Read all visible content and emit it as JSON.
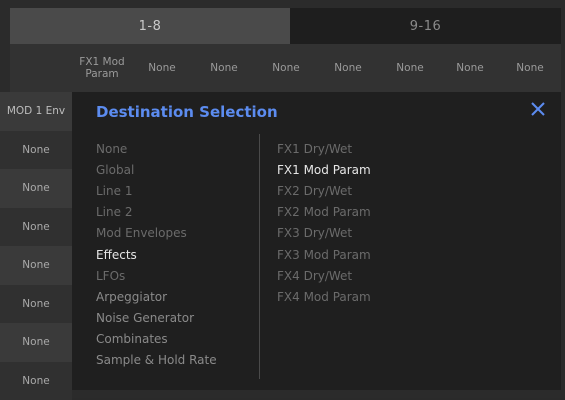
{
  "tabs": [
    {
      "label": "1-8"
    },
    {
      "label": "9-16"
    }
  ],
  "header": {
    "slots": [
      "FX1 Mod\nParam",
      "None",
      "None",
      "None",
      "None",
      "None",
      "None",
      "None"
    ]
  },
  "left_column": {
    "head": "MOD 1 Env",
    "rows": [
      "None",
      "None",
      "None",
      "None",
      "None",
      "None",
      "None"
    ]
  },
  "modal": {
    "title": "Destination Selection",
    "close_icon": "close-icon",
    "accent_color": "#5c8cf0",
    "categories": [
      "None",
      "Global",
      "Line 1",
      "Line 2",
      "Mod Envelopes",
      "Effects",
      "LFOs",
      "Arpeggiator",
      "Noise Generator",
      "Combinates",
      "Sample & Hold Rate"
    ],
    "selected_category": "Effects",
    "destinations": [
      "FX1 Dry/Wet",
      "FX1 Mod Param",
      "FX2 Dry/Wet",
      "FX2 Mod Param",
      "FX3 Dry/Wet",
      "FX3 Mod Param",
      "FX4 Dry/Wet",
      "FX4 Mod Param"
    ],
    "selected_destination": "FX1 Mod Param"
  }
}
